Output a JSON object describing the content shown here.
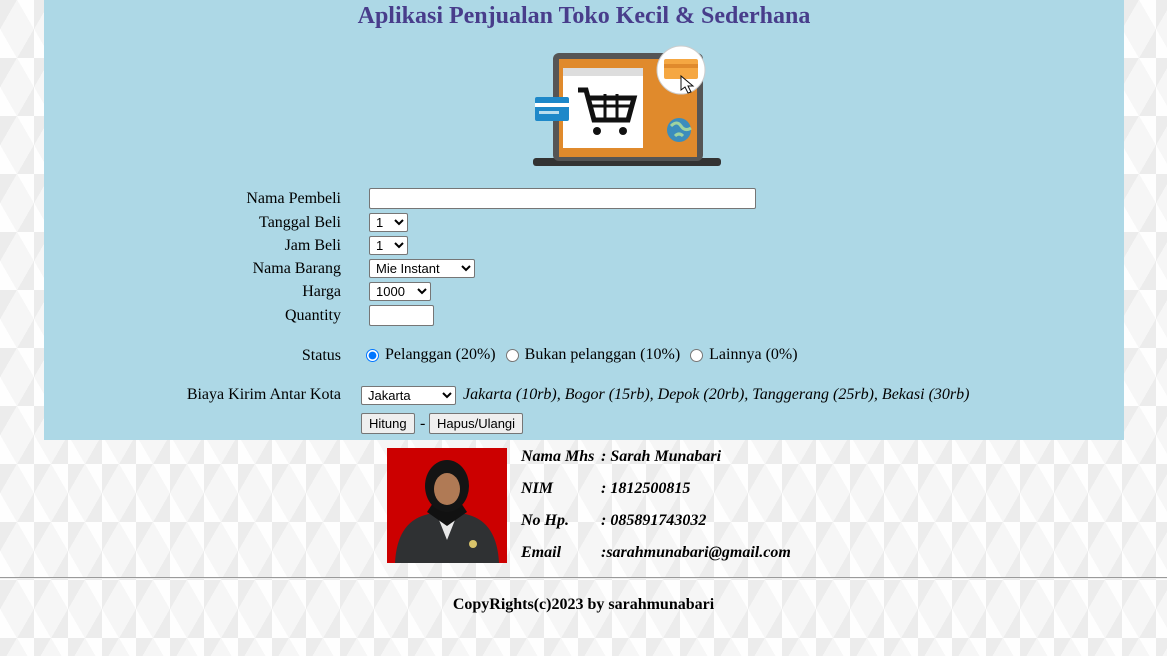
{
  "app": {
    "title": "Aplikasi Penjualan Toko Kecil & Sederhana"
  },
  "form": {
    "nama_pembeli": {
      "label": "Nama Pembeli",
      "value": ""
    },
    "tanggal_beli": {
      "label": "Tanggal Beli",
      "selected": "1"
    },
    "jam_beli": {
      "label": "Jam Beli",
      "selected": "1"
    },
    "nama_barang": {
      "label": "Nama Barang",
      "selected": "Mie Instant"
    },
    "harga": {
      "label": "Harga",
      "selected": "1000"
    },
    "quantity": {
      "label": "Quantity",
      "value": ""
    },
    "status": {
      "label": "Status",
      "options": [
        "Pelanggan (20%)",
        "Bukan pelanggan (10%)",
        "Lainnya (0%)"
      ],
      "selected_index": 0
    },
    "biaya_kirim": {
      "label": "Biaya Kirim Antar Kota",
      "selected": "Jakarta",
      "note": "Jakarta (10rb), Bogor (15rb), Depok (20rb), Tanggerang (25rb), Bekasi (30rb)"
    },
    "buttons": {
      "hitung": "Hitung",
      "separator": "-",
      "reset": "Hapus/Ulangi"
    }
  },
  "profile": {
    "nama_label": "Nama Mhs",
    "nama_value": ": Sarah Munabari",
    "nim_label": "NIM",
    "nim_value": ": 1812500815",
    "hp_label": "No Hp.",
    "hp_value": ": 085891743032",
    "email_label": "Email",
    "email_value": ":sarahmunabari@gmail.com"
  },
  "footer": {
    "text": "CopyRights(c)2023 by sarahmunabari"
  },
  "colors": {
    "panel": "#add8e6",
    "title": "#483d8b",
    "photo_bg": "#cc0000"
  }
}
